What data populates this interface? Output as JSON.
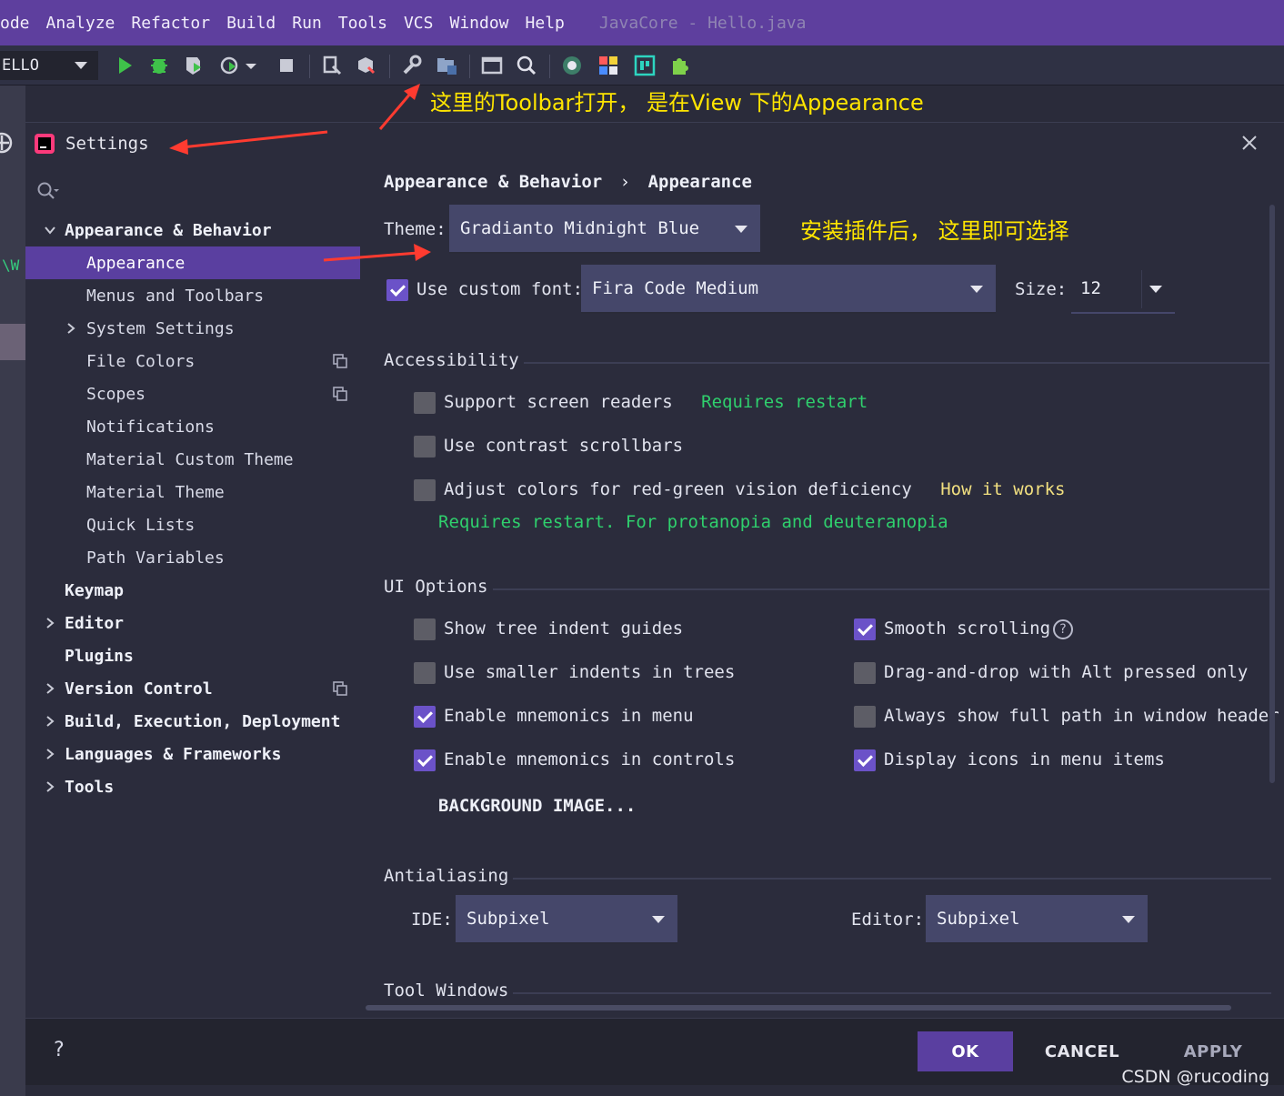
{
  "menu": {
    "items": [
      "ode",
      "Analyze",
      "Refactor",
      "Build",
      "Run",
      "Tools",
      "VCS",
      "Window",
      "Help"
    ],
    "window_title": "JavaCore - Hello.java"
  },
  "toolbar": {
    "run_config": "ELLO",
    "icons": [
      "run-icon",
      "debug-icon",
      "coverage-icon",
      "profile-icon",
      "stop-icon",
      "build-icon",
      "rebuild-icon",
      "settings-wrench-icon",
      "project-structure-icon",
      "terminal-icon",
      "search-icon",
      "plugin-circle-icon",
      "color-grid-icon",
      "qr-icon",
      "puzzle-icon"
    ]
  },
  "annotations": {
    "toolbar_note": "这里的Toolbar打开， 是在View 下的Appearance",
    "theme_note": "安装插件后， 这里即可选择"
  },
  "background": {
    "side_text": "\\W"
  },
  "dialog": {
    "title": "Settings",
    "sidebar": {
      "items": [
        {
          "label": "Appearance & Behavior",
          "bold": true,
          "expanded": true
        },
        {
          "label": "Appearance",
          "selected": true
        },
        {
          "label": "Menus and Toolbars"
        },
        {
          "label": "System Settings"
        },
        {
          "label": "File Colors"
        },
        {
          "label": "Scopes"
        },
        {
          "label": "Notifications"
        },
        {
          "label": "Material Custom Theme"
        },
        {
          "label": "Material Theme"
        },
        {
          "label": "Quick Lists"
        },
        {
          "label": "Path Variables"
        },
        {
          "label": "Keymap"
        },
        {
          "label": "Editor"
        },
        {
          "label": "Plugins"
        },
        {
          "label": "Version Control"
        },
        {
          "label": "Build, Execution, Deployment"
        },
        {
          "label": "Languages & Frameworks"
        },
        {
          "label": "Tools"
        }
      ]
    },
    "breadcrumb": {
      "parent": "Appearance & Behavior",
      "separator": "›",
      "current": "Appearance"
    },
    "theme": {
      "label": "Theme:",
      "value": "Gradianto Midnight Blue"
    },
    "font": {
      "checkbox_label": "Use custom font:",
      "checked": true,
      "value": "Fira Code Medium",
      "size_label": "Size:",
      "size_value": "12"
    },
    "accessibility": {
      "title": "Accessibility",
      "screen_readers": {
        "label": "Support screen readers",
        "note": "Requires restart",
        "checked": false
      },
      "contrast_scrollbars": {
        "label": "Use contrast scrollbars",
        "checked": false
      },
      "red_green": {
        "label": "Adjust colors for red-green vision deficiency",
        "link": "How it works",
        "note": "Requires restart. For protanopia and deuteranopia",
        "checked": false
      }
    },
    "ui_options": {
      "title": "UI Options",
      "left": [
        {
          "label": "Show tree indent guides",
          "checked": false
        },
        {
          "label": "Use smaller indents in trees",
          "checked": false
        },
        {
          "label": "Enable mnemonics in menu",
          "checked": true
        },
        {
          "label": "Enable mnemonics in controls",
          "checked": true
        }
      ],
      "right": [
        {
          "label": "Smooth scrolling",
          "checked": true
        },
        {
          "label": "Drag-and-drop with Alt pressed only",
          "checked": false
        },
        {
          "label": "Always show full path in window header",
          "checked": false
        },
        {
          "label": "Display icons in menu items",
          "checked": true
        }
      ],
      "help_glyph": "?",
      "background_button": "BACKGROUND IMAGE..."
    },
    "antialiasing": {
      "title": "Antialiasing",
      "ide_label": "IDE:",
      "ide_value": "Subpixel",
      "editor_label": "Editor:",
      "editor_value": "Subpixel"
    },
    "tool_windows": {
      "title": "Tool Windows"
    },
    "footer": {
      "help": "?",
      "ok": "OK",
      "cancel": "CANCEL",
      "apply": "APPLY"
    }
  },
  "watermark": "CSDN @rucoding",
  "colors": {
    "menubar": "#5e3f9e",
    "accent": "#5a3fa0",
    "dialog_bg": "#2b2c3c",
    "combo_bg": "#45476a",
    "green_note": "#2fd06d",
    "annotation": "#ffe500",
    "arrow": "#ff3b30"
  }
}
